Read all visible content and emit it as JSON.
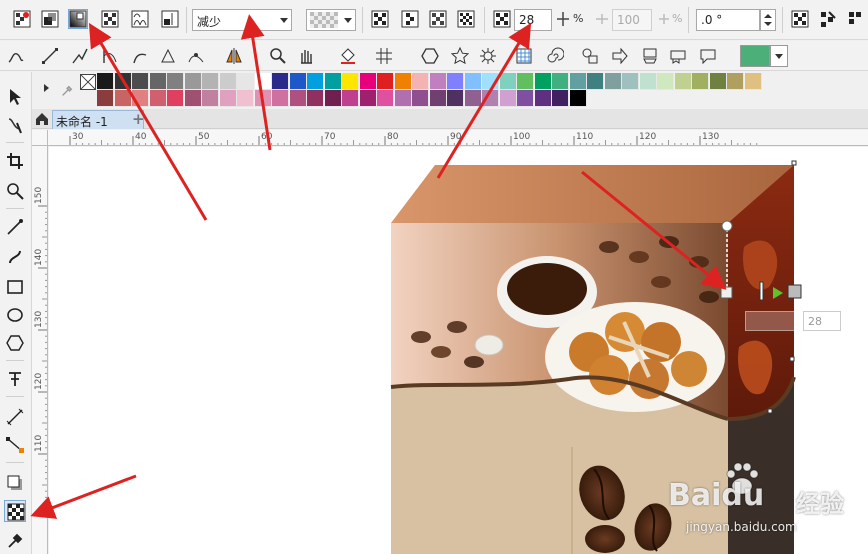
{
  "property_bar": {
    "merge_mode": "减少",
    "transparency_value": "28",
    "percent_sign": "%",
    "feather_value": "100",
    "percent_sign_2": "%",
    "angle_value": ".0 °"
  },
  "document": {
    "tab_title": "未命名 -1"
  },
  "rulers": {
    "top_ticks": [
      "30",
      "40",
      "50",
      "60",
      "70",
      "80",
      "90",
      "100",
      "110",
      "120",
      "130"
    ],
    "left_ticks": [
      "150",
      "140",
      "130",
      "120",
      "110"
    ]
  },
  "canvas": {
    "transparency_readout": "28"
  },
  "palette": {
    "row1": [
      "#1a1a1a",
      "#333333",
      "#4d4d4d",
      "#666666",
      "#808080",
      "#999999",
      "#b3b3b3",
      "#cccccc",
      "#e6e6e6",
      "#ffffff",
      "#2a2a8c",
      "#1e58c8",
      "#00a0e0",
      "#00a0a0",
      "#ffe600",
      "#e8007a",
      "#e02020",
      "#f08000",
      "#f4b3b3",
      "#c080c0",
      "#8080ff",
      "#80c0ff",
      "#a0e0ff",
      "#80d0c0",
      "#60c060",
      "#00a060",
      "#40b080",
      "#60a0a0",
      "#408080",
      "#80a0a0",
      "#a0c0c0",
      "#c0e0d0",
      "#d0e8c0",
      "#c0d090",
      "#a0b060",
      "#708040",
      "#b0a060",
      "#e0c080"
    ],
    "row2": [
      "#8b3c3c",
      "#c86464",
      "#e08080",
      "#d06070",
      "#e04060",
      "#a05070",
      "#c080a0",
      "#e0a0c0",
      "#f0c0d0",
      "#e090b0",
      "#d070a0",
      "#b05080",
      "#903060",
      "#702050",
      "#c04090",
      "#a02070",
      "#e050a0",
      "#b070b0",
      "#905090",
      "#704070",
      "#503060",
      "#906090",
      "#b080b0",
      "#d0a0d0",
      "#8050a0",
      "#603080",
      "#402060",
      "#000000"
    ]
  },
  "watermark": {
    "brand": "Baidu",
    "brand_cn": "经验",
    "url": "jingyan.baidu.com"
  },
  "colors": {
    "fill_swatch": "#4caf7a",
    "accent": "#7aa7d6"
  }
}
